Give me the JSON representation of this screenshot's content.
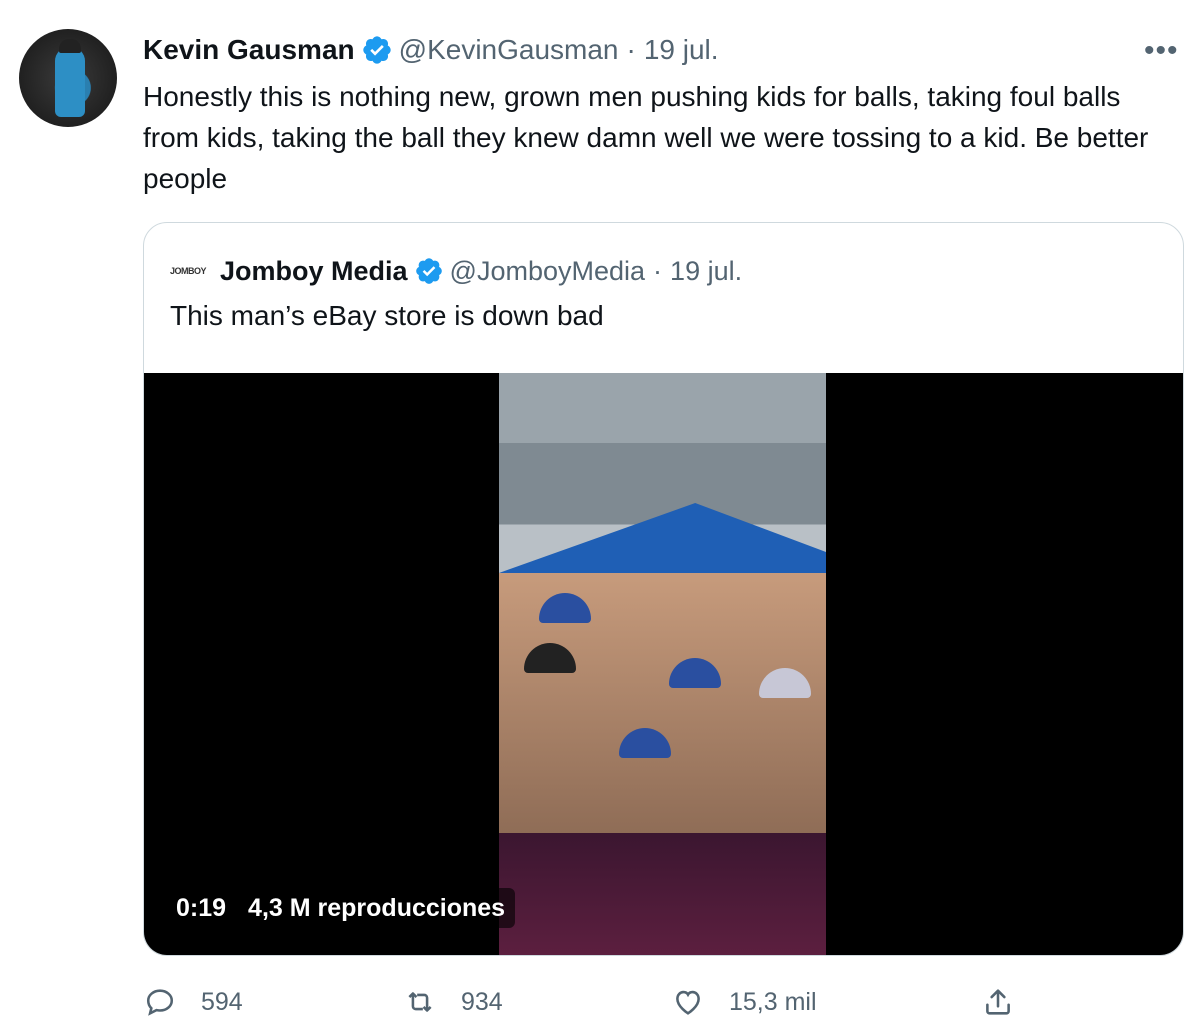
{
  "tweet": {
    "author_name": "Kevin Gausman",
    "handle": "@KevinGausman",
    "separator": "·",
    "date": "19 jul.",
    "more_label": "•••",
    "text": "Honestly this is nothing new, grown men pushing kids for balls, taking foul balls from kids, taking the ball they knew damn well we were tossing to a kid. Be better people"
  },
  "quoted": {
    "logo_text": "JOMBOY",
    "author_name": "Jomboy Media",
    "handle": "@JomboyMedia",
    "separator": "·",
    "date": "19 jul.",
    "text": "This man’s eBay store is down bad",
    "video": {
      "duration": "0:19",
      "views": "4,3 M reproducciones"
    }
  },
  "actions": {
    "reply_count": "594",
    "retweet_count": "934",
    "like_count": "15,3 mil"
  },
  "colors": {
    "verified": "#1d9bf0",
    "secondary_text": "#536471",
    "border": "#cfd9de"
  },
  "icons": [
    "verified-badge-icon",
    "more-icon",
    "reply-icon",
    "retweet-icon",
    "like-icon",
    "share-icon"
  ]
}
